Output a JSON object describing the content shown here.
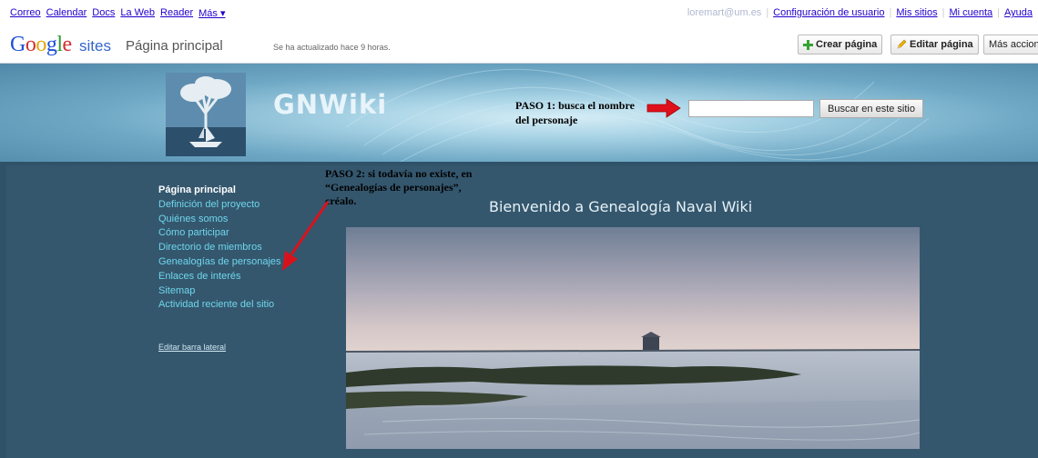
{
  "gbar": {
    "links": [
      "Correo",
      "Calendar",
      "Docs",
      "La Web",
      "Reader",
      "Más ▾"
    ],
    "email": "loremart@um.es",
    "settings_label": "Configuración de usuario",
    "my_sites_label": "Mis sitios",
    "my_account_label": "Mi cuenta",
    "help_label": "Ayuda"
  },
  "header": {
    "logo_sites": "sites",
    "page_name": "Página principal",
    "updated": "Se ha actualizado hace 9 horas.",
    "create_label": "Crear página",
    "edit_label": "Editar página",
    "more_label": "Más acciones"
  },
  "banner": {
    "site_title": "GNWiki",
    "step1": "PASO 1: busca el nombre del personaje",
    "search_placeholder": "",
    "search_button": "Buscar en este sitio"
  },
  "sidebar": {
    "items": [
      {
        "label": "Página principal",
        "active": true
      },
      {
        "label": "Definición del proyecto"
      },
      {
        "label": "Quiénes somos"
      },
      {
        "label": "Cómo participar"
      },
      {
        "label": "Directorio de miembros"
      },
      {
        "label": "Genealogías de personajes"
      },
      {
        "label": "Enlaces de interés"
      },
      {
        "label": "Sitemap"
      },
      {
        "label": "Actividad reciente del sitio"
      }
    ],
    "edit_label": "Editar barra lateral"
  },
  "annotations": {
    "step2": "PASO 2: si todavía no existe, en “Genealogías de personajes”, créalo."
  },
  "content": {
    "welcome": "Bienvenido a Genealogía Naval Wiki"
  },
  "colors": {
    "link": "#2200cc",
    "nav_link": "#6fd6ec",
    "main_bg": "#34576e",
    "arrow": "#e0101a"
  }
}
